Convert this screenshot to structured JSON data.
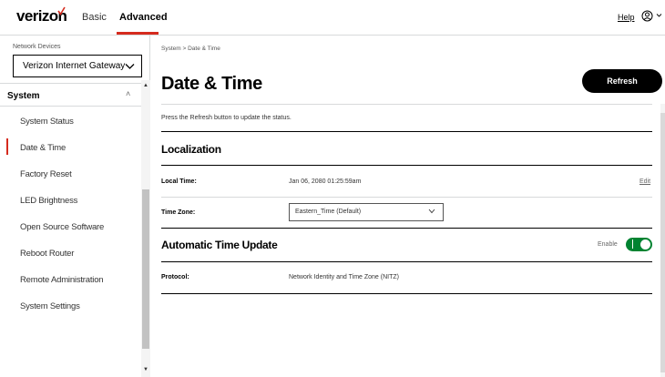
{
  "header": {
    "logo": "verizon",
    "tabs": [
      {
        "label": "Basic",
        "active": false
      },
      {
        "label": "Advanced",
        "active": true
      }
    ],
    "help_label": "Help",
    "accent_color": "#d52b1e"
  },
  "sidebar": {
    "device_label": "Network Devices",
    "device_selected": "Verizon Internet Gateway",
    "section_title": "System",
    "items": [
      {
        "label": "System Status"
      },
      {
        "label": "Date & Time",
        "active": true
      },
      {
        "label": "Factory Reset"
      },
      {
        "label": "LED Brightness"
      },
      {
        "label": "Open Source Software"
      },
      {
        "label": "Reboot Router"
      },
      {
        "label": "Remote Administration"
      },
      {
        "label": "System Settings"
      }
    ]
  },
  "main": {
    "breadcrumb": "System  >  Date & Time",
    "title": "Date & Time",
    "refresh_label": "Refresh",
    "status_text": "Press the Refresh button to update the status.",
    "localization": {
      "title": "Localization",
      "local_time_label": "Local Time:",
      "local_time_value": "Jan 06, 2080 01:25:59am",
      "edit_label": "Edit",
      "time_zone_label": "Time Zone:",
      "time_zone_value": "Eastern_Time (Default)"
    },
    "auto_update": {
      "title": "Automatic Time Update",
      "enable_label": "Enable",
      "enabled": true,
      "toggle_color": "#008331",
      "protocol_label": "Protocol:",
      "protocol_value": "Network Identity and Time Zone (NITZ)"
    }
  }
}
